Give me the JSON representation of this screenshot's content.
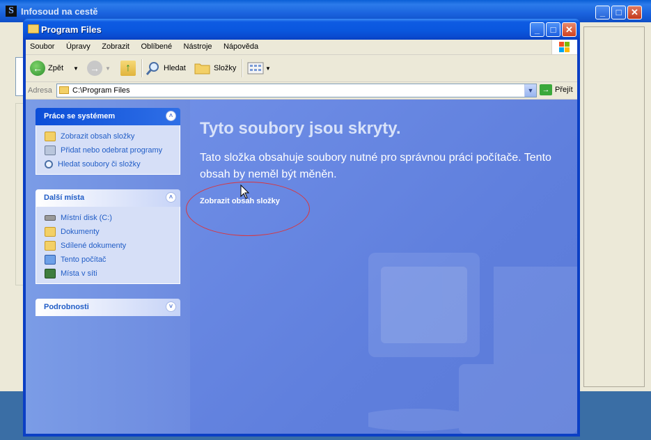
{
  "background_window": {
    "title": "Infosoud na cestě",
    "controls": [
      "_",
      "□",
      "✕"
    ]
  },
  "window": {
    "title": "Program Files",
    "controls": {
      "minimize": "_",
      "maximize": "□",
      "close": "✕"
    }
  },
  "menu": [
    "Soubor",
    "Úpravy",
    "Zobrazit",
    "Oblíbené",
    "Nástroje",
    "Nápověda"
  ],
  "toolbar": {
    "back_label": "Zpět",
    "search_label": "Hledat",
    "folders_label": "Složky"
  },
  "address": {
    "label": "Adresa",
    "value": "C:\\Program Files",
    "go_label": "Přejít"
  },
  "taskpane": {
    "system_tasks": {
      "title": "Práce se systémem",
      "items": [
        "Zobrazit obsah složky",
        "Přidat nebo odebrat programy",
        "Hledat soubory či složky"
      ]
    },
    "other_places": {
      "title": "Další místa",
      "items": [
        "Místní disk (C:)",
        "Dokumenty",
        "Sdílené dokumenty",
        "Tento počítač",
        "Místa v síti"
      ]
    },
    "details": {
      "title": "Podrobnosti"
    }
  },
  "main": {
    "heading": "Tyto soubory jsou skryty.",
    "message": "Tato složka obsahuje soubory nutné pro správnou práci počítače. Tento obsah by neměl být měněn.",
    "show_contents_link": "Zobrazit obsah složky"
  },
  "icons": {
    "back": "back-arrow-icon",
    "forward": "forward-arrow-icon",
    "up": "up-folder-icon",
    "search": "search-icon",
    "folders": "folders-icon",
    "views": "views-icon"
  },
  "colors": {
    "titlebar": "#0a57de",
    "content_bg": "#6b8ae3",
    "annotation": "#d9363e"
  }
}
